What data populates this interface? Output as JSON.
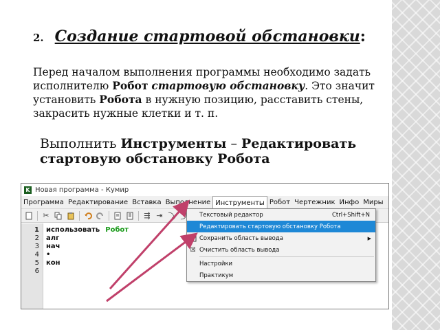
{
  "heading": {
    "number": "2.",
    "title": "Создание стартовой обстановки",
    "colon": ":"
  },
  "paragraph": {
    "part1": "Перед началом выполнения программы необходимо задать исполнителю ",
    "bold1": "Робот",
    "italic1": "стартовую обстановку",
    "part2": ". Это значит установить ",
    "bold2": "Робота",
    "part3": " в нужную позицию, расставить стены, закрасить нужные клетки и т. п."
  },
  "instruction": {
    "prefix": "Выполнить ",
    "bold1": "Инструменты",
    "dash": " – ",
    "bold2": "Редактировать стартовую обстановку Робота"
  },
  "window": {
    "title": "Новая программа - Кумир",
    "app_icon": "K",
    "menu": [
      "Программа",
      "Редактирование",
      "Вставка",
      "Выполнение",
      "Инструменты",
      "Робот",
      "Чертежник",
      "Инфо",
      "Миры"
    ],
    "active_menu": "Инструменты",
    "line_numbers": [
      "1",
      "2",
      "3",
      "4",
      "5",
      "6"
    ],
    "code": {
      "line1_kw": "использовать",
      "line1_name": "Робот",
      "line2": "алг",
      "line3": "нач",
      "line4": "•",
      "line5": "кон"
    },
    "dropdown": {
      "items": [
        {
          "label": "Текстовый редактор",
          "shortcut": "Ctrl+Shift+N"
        },
        {
          "label": "Редактировать стартовую обстановку Робота"
        },
        {
          "label": "Сохранить область вывода"
        },
        {
          "label": "Очистить область вывода"
        },
        {
          "label": "Настройки"
        },
        {
          "label": "Практикум"
        }
      ],
      "submenu_arrow": "▶",
      "check_icon": "☒"
    }
  },
  "colors": {
    "accent_arrow": "#c0406a",
    "selection": "#1e88d6",
    "robot_keyword": "#1a9a1a"
  }
}
